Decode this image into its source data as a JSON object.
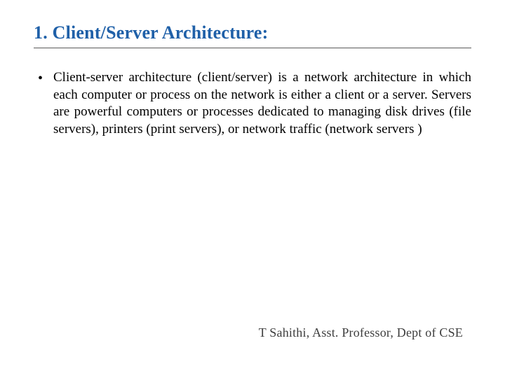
{
  "title": "1. Client/Server Architecture:",
  "bullets": [
    "Client-server architecture (client/server) is a network architecture in which each computer or process on the network is either a client or a server. Servers are powerful computers or processes dedicated to managing disk drives (file servers), printers (print servers), or network traffic (network servers )"
  ],
  "footer": "T Sahithi, Asst. Professor, Dept of CSE"
}
